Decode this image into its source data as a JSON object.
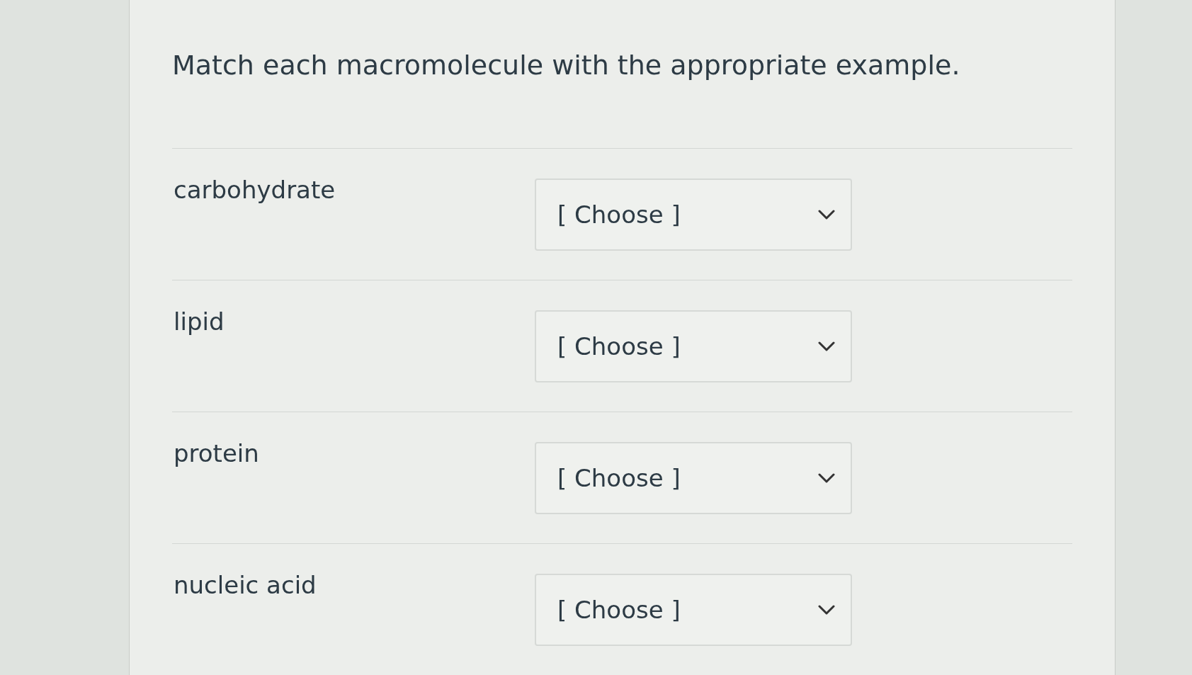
{
  "question": {
    "prompt": "Match each macromolecule with the appropriate example.",
    "rows": [
      {
        "label": "carbohydrate",
        "select": {
          "value": "[ Choose ]"
        }
      },
      {
        "label": "lipid",
        "select": {
          "value": "[ Choose ]"
        }
      },
      {
        "label": "protein",
        "select": {
          "value": "[ Choose ]"
        }
      },
      {
        "label": "nucleic acid",
        "select": {
          "value": "[ Choose ]"
        }
      }
    ]
  }
}
